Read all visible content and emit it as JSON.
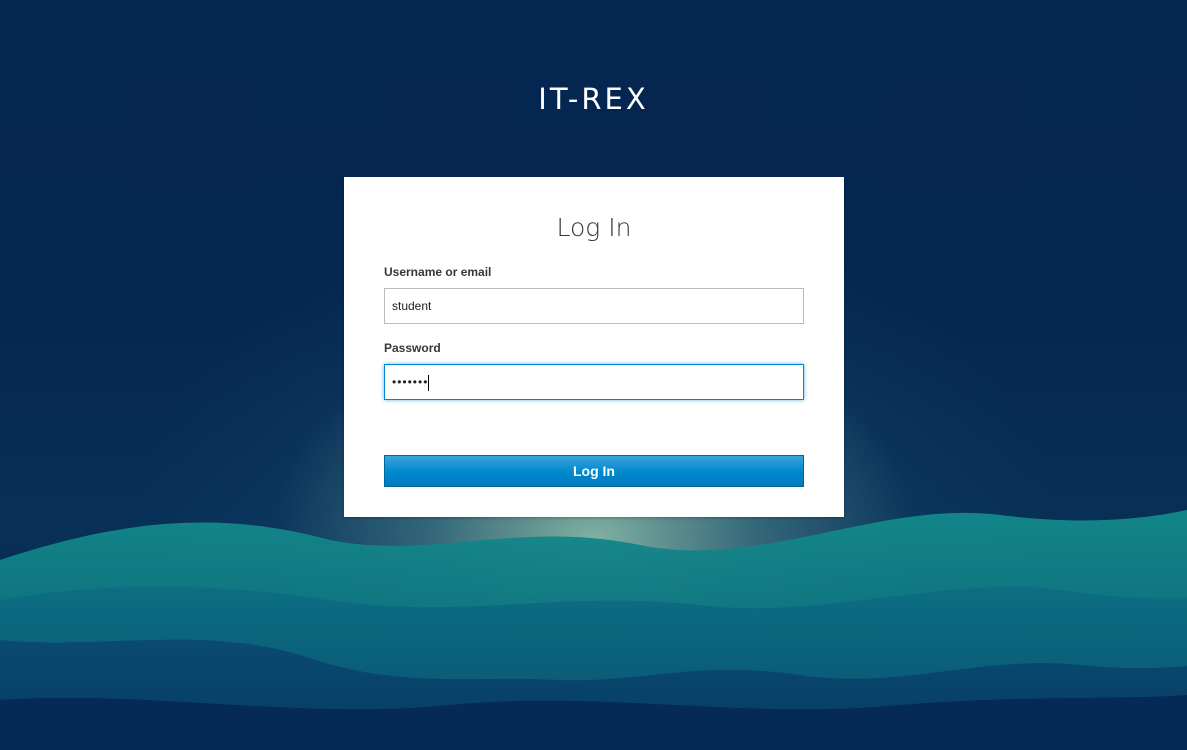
{
  "brand": {
    "title": "IT-REX"
  },
  "login": {
    "heading": "Log In",
    "username_label": "Username or email",
    "username_value": "student",
    "password_label": "Password",
    "password_masked": "•••••••",
    "submit_label": "Log In"
  },
  "colors": {
    "background": "#04234b",
    "accent": "#0088ce",
    "card": "#ffffff"
  }
}
